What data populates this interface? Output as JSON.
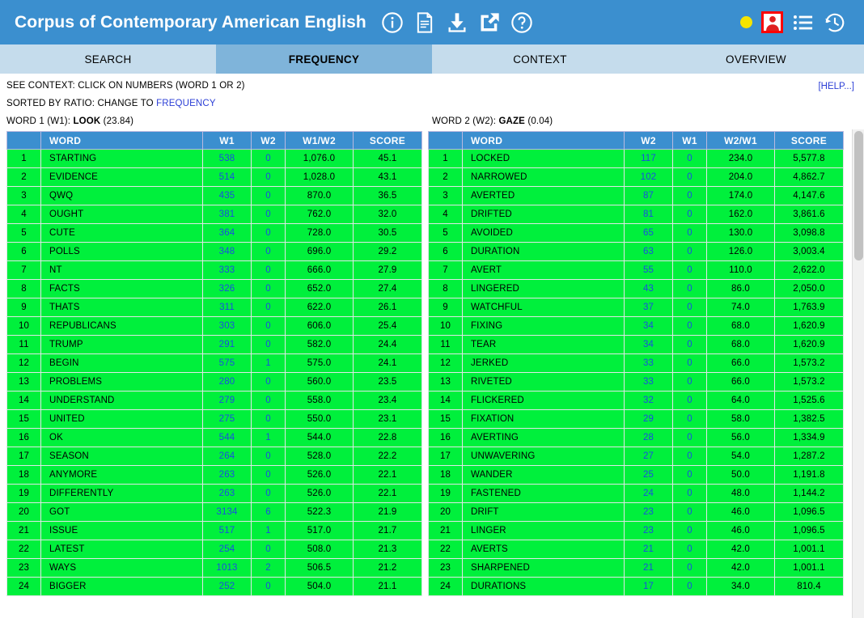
{
  "header": {
    "title": "Corpus of Contemporary American English",
    "icons": [
      "info-icon",
      "document-icon",
      "download-icon",
      "external-link-icon",
      "help-icon"
    ],
    "right_icons": [
      "status-dot",
      "user-account-icon",
      "list-icon",
      "history-icon"
    ],
    "brand_blue": "#3b8fcf",
    "status_dot_color": "#f5e400",
    "user_box_border": "#ff0000"
  },
  "tabs": [
    {
      "label": "SEARCH",
      "active": false
    },
    {
      "label": "FREQUENCY",
      "active": true
    },
    {
      "label": "CONTEXT",
      "active": false
    },
    {
      "label": "OVERVIEW",
      "active": false
    }
  ],
  "info": {
    "line1": "SEE CONTEXT: CLICK ON NUMBERS (WORD 1 OR 2)",
    "line2_prefix": "SORTED BY RATIO: CHANGE TO ",
    "line2_link": "FREQUENCY",
    "help": "[HELP...]"
  },
  "word1": {
    "prefix": "WORD 1 (W1): ",
    "word": "LOOK",
    "freq": " (23.84)"
  },
  "word2": {
    "prefix": "WORD 2 (W2): ",
    "word": "GAZE",
    "freq": " (0.04)"
  },
  "left_table": {
    "columns": [
      "",
      "WORD",
      "W1",
      "W2",
      "W1/W2",
      "SCORE"
    ],
    "rows": [
      [
        "1",
        "STARTING",
        "538",
        "0",
        "1,076.0",
        "45.1"
      ],
      [
        "2",
        "EVIDENCE",
        "514",
        "0",
        "1,028.0",
        "43.1"
      ],
      [
        "3",
        "QWQ",
        "435",
        "0",
        "870.0",
        "36.5"
      ],
      [
        "4",
        "OUGHT",
        "381",
        "0",
        "762.0",
        "32.0"
      ],
      [
        "5",
        "CUTE",
        "364",
        "0",
        "728.0",
        "30.5"
      ],
      [
        "6",
        "POLLS",
        "348",
        "0",
        "696.0",
        "29.2"
      ],
      [
        "7",
        "NT",
        "333",
        "0",
        "666.0",
        "27.9"
      ],
      [
        "8",
        "FACTS",
        "326",
        "0",
        "652.0",
        "27.4"
      ],
      [
        "9",
        "THATS",
        "311",
        "0",
        "622.0",
        "26.1"
      ],
      [
        "10",
        "REPUBLICANS",
        "303",
        "0",
        "606.0",
        "25.4"
      ],
      [
        "11",
        "TRUMP",
        "291",
        "0",
        "582.0",
        "24.4"
      ],
      [
        "12",
        "BEGIN",
        "575",
        "1",
        "575.0",
        "24.1"
      ],
      [
        "13",
        "PROBLEMS",
        "280",
        "0",
        "560.0",
        "23.5"
      ],
      [
        "14",
        "UNDERSTAND",
        "279",
        "0",
        "558.0",
        "23.4"
      ],
      [
        "15",
        "UNITED",
        "275",
        "0",
        "550.0",
        "23.1"
      ],
      [
        "16",
        "OK",
        "544",
        "1",
        "544.0",
        "22.8"
      ],
      [
        "17",
        "SEASON",
        "264",
        "0",
        "528.0",
        "22.2"
      ],
      [
        "18",
        "ANYMORE",
        "263",
        "0",
        "526.0",
        "22.1"
      ],
      [
        "19",
        "DIFFERENTLY",
        "263",
        "0",
        "526.0",
        "22.1"
      ],
      [
        "20",
        "GOT",
        "3134",
        "6",
        "522.3",
        "21.9"
      ],
      [
        "21",
        "ISSUE",
        "517",
        "1",
        "517.0",
        "21.7"
      ],
      [
        "22",
        "LATEST",
        "254",
        "0",
        "508.0",
        "21.3"
      ],
      [
        "23",
        "WAYS",
        "1013",
        "2",
        "506.5",
        "21.2"
      ],
      [
        "24",
        "BIGGER",
        "252",
        "0",
        "504.0",
        "21.1"
      ]
    ]
  },
  "right_table": {
    "columns": [
      "",
      "WORD",
      "W2",
      "W1",
      "W2/W1",
      "SCORE"
    ],
    "rows": [
      [
        "1",
        "LOCKED",
        "117",
        "0",
        "234.0",
        "5,577.8"
      ],
      [
        "2",
        "NARROWED",
        "102",
        "0",
        "204.0",
        "4,862.7"
      ],
      [
        "3",
        "AVERTED",
        "87",
        "0",
        "174.0",
        "4,147.6"
      ],
      [
        "4",
        "DRIFTED",
        "81",
        "0",
        "162.0",
        "3,861.6"
      ],
      [
        "5",
        "AVOIDED",
        "65",
        "0",
        "130.0",
        "3,098.8"
      ],
      [
        "6",
        "DURATION",
        "63",
        "0",
        "126.0",
        "3,003.4"
      ],
      [
        "7",
        "AVERT",
        "55",
        "0",
        "110.0",
        "2,622.0"
      ],
      [
        "8",
        "LINGERED",
        "43",
        "0",
        "86.0",
        "2,050.0"
      ],
      [
        "9",
        "WATCHFUL",
        "37",
        "0",
        "74.0",
        "1,763.9"
      ],
      [
        "10",
        "FIXING",
        "34",
        "0",
        "68.0",
        "1,620.9"
      ],
      [
        "11",
        "TEAR",
        "34",
        "0",
        "68.0",
        "1,620.9"
      ],
      [
        "12",
        "JERKED",
        "33",
        "0",
        "66.0",
        "1,573.2"
      ],
      [
        "13",
        "RIVETED",
        "33",
        "0",
        "66.0",
        "1,573.2"
      ],
      [
        "14",
        "FLICKERED",
        "32",
        "0",
        "64.0",
        "1,525.6"
      ],
      [
        "15",
        "FIXATION",
        "29",
        "0",
        "58.0",
        "1,382.5"
      ],
      [
        "16",
        "AVERTING",
        "28",
        "0",
        "56.0",
        "1,334.9"
      ],
      [
        "17",
        "UNWAVERING",
        "27",
        "0",
        "54.0",
        "1,287.2"
      ],
      [
        "18",
        "WANDER",
        "25",
        "0",
        "50.0",
        "1,191.8"
      ],
      [
        "19",
        "FASTENED",
        "24",
        "0",
        "48.0",
        "1,144.2"
      ],
      [
        "20",
        "DRIFT",
        "23",
        "0",
        "46.0",
        "1,096.5"
      ],
      [
        "21",
        "LINGER",
        "23",
        "0",
        "46.0",
        "1,096.5"
      ],
      [
        "22",
        "AVERTS",
        "21",
        "0",
        "42.0",
        "1,001.1"
      ],
      [
        "23",
        "SHARPENED",
        "21",
        "0",
        "42.0",
        "1,001.1"
      ],
      [
        "24",
        "DURATIONS",
        "17",
        "0",
        "34.0",
        "810.4"
      ]
    ]
  }
}
